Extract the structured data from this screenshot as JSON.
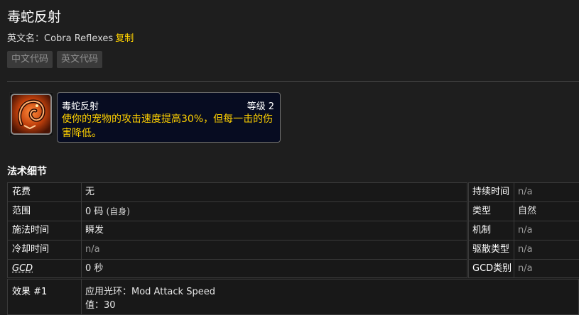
{
  "spell": {
    "title": "毒蛇反射",
    "english_label": "英文名：Cobra Reflexes",
    "copy_label": "复制",
    "code_buttons": {
      "cn": "中文代码",
      "en": "英文代码"
    },
    "icon": "cobra-reflexes-icon"
  },
  "tooltip": {
    "name": "毒蛇反射",
    "level": "等级 2",
    "description": "使你的宠物的攻击速度提高30%，但每一击的伤害降低。"
  },
  "details": {
    "section_title": "法术细节",
    "left_rows": [
      {
        "key": "花费",
        "value": "无"
      },
      {
        "key": "范围",
        "value": "0 码",
        "paren": "(自身)"
      },
      {
        "key": "施法时间",
        "value": "瞬发"
      },
      {
        "key": "冷却时间",
        "value": "n/a"
      },
      {
        "key": "GCD",
        "value": "0 秒"
      }
    ],
    "right_rows": [
      {
        "key": "持续时间",
        "value": "n/a"
      },
      {
        "key": "类型",
        "value": "自然"
      },
      {
        "key": "机制",
        "value": "n/a"
      },
      {
        "key": "驱散类型",
        "value": "n/a"
      },
      {
        "key": "GCD类别",
        "value": "n/a"
      }
    ],
    "effect": {
      "key": "效果 #1",
      "line1": "应用光环：Mod Attack Speed",
      "line2": "值：30"
    }
  },
  "colors": {
    "background": "#1e1e1e",
    "accent_yellow": "#ffd100",
    "tooltip_bg": "#070c21"
  }
}
